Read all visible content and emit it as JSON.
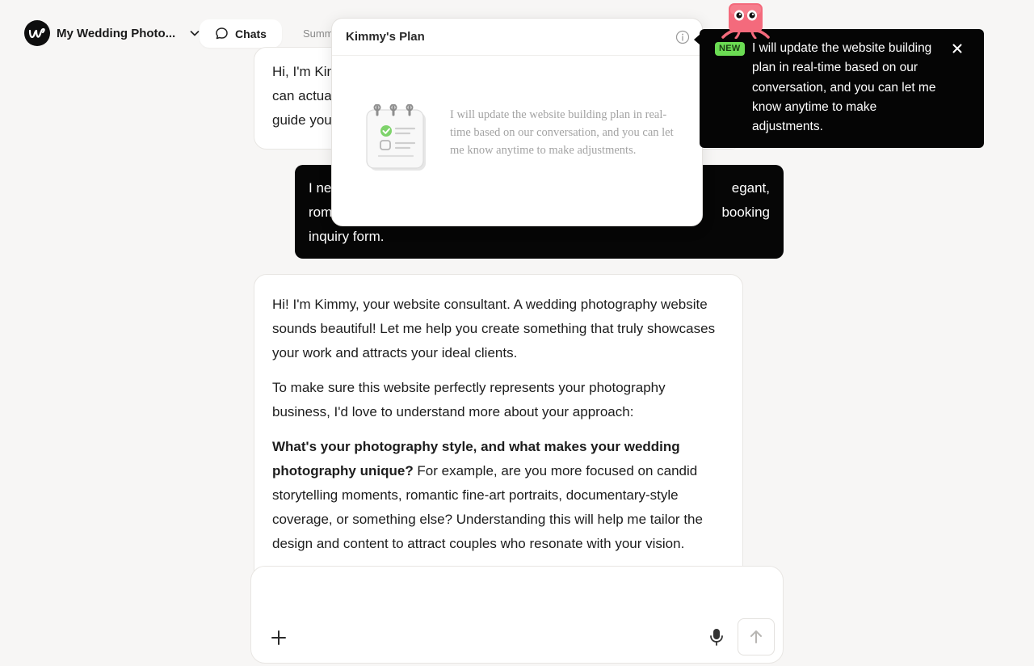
{
  "header": {
    "project_name": "My Wedding Photo...",
    "tabs": [
      {
        "label": "Chats",
        "active": true
      },
      {
        "label": "Summary",
        "active": false
      }
    ]
  },
  "chat": {
    "messages": [
      {
        "role": "assistant",
        "lines": [
          "Hi, I'm Kim",
          "can actua",
          "guide you"
        ]
      },
      {
        "role": "user",
        "line1_left": "I ne",
        "line1_right": "egant,",
        "line2_left": "rom",
        "line2_right": "booking",
        "line3": "inquiry form."
      },
      {
        "role": "assistant",
        "paragraph1": "Hi! I'm Kimmy, your website consultant. A wedding photography website sounds beautiful! Let me help you create something that truly showcases your work and attracts your ideal clients.",
        "paragraph2": "To make sure this website perfectly represents your photography business, I'd love to understand more about your approach:",
        "question_bold": "What's your photography style, and what makes your wedding photography unique?",
        "question_rest": " For example, are you more focused on candid storytelling moments, romantic fine-art portraits, documentary-style coverage, or something else? Understanding this will help me tailor the design and content to attract couples who resonate with your vision."
      }
    ]
  },
  "plan_panel": {
    "title": "Kimmy's Plan",
    "description": "I will update the website building plan in real-time based on our conversation, and you can let me know anytime to make adjustments."
  },
  "tooltip": {
    "badge": "NEW",
    "text": "I will update the website building plan in real-time based on our conversation, and you can let me know anytime to make adjustments."
  },
  "composer": {
    "placeholder": ""
  },
  "colors": {
    "background": "#f7f6f5",
    "user_bubble": "#060606",
    "badge_green": "#6bdc53",
    "mascot_pink": "#f46a7c"
  },
  "icons": {
    "logo": "brand-logo-icon",
    "project_menu": "chevron-down-icon",
    "chats_tab": "chat-bubble-icon",
    "plan_info": "info-icon",
    "plan_illustration": "checklist-notepad-icon",
    "tooltip_close": "close-icon",
    "mascot": "mascot-icon",
    "attach": "plus-icon",
    "voice": "microphone-icon",
    "send": "arrow-up-icon"
  }
}
